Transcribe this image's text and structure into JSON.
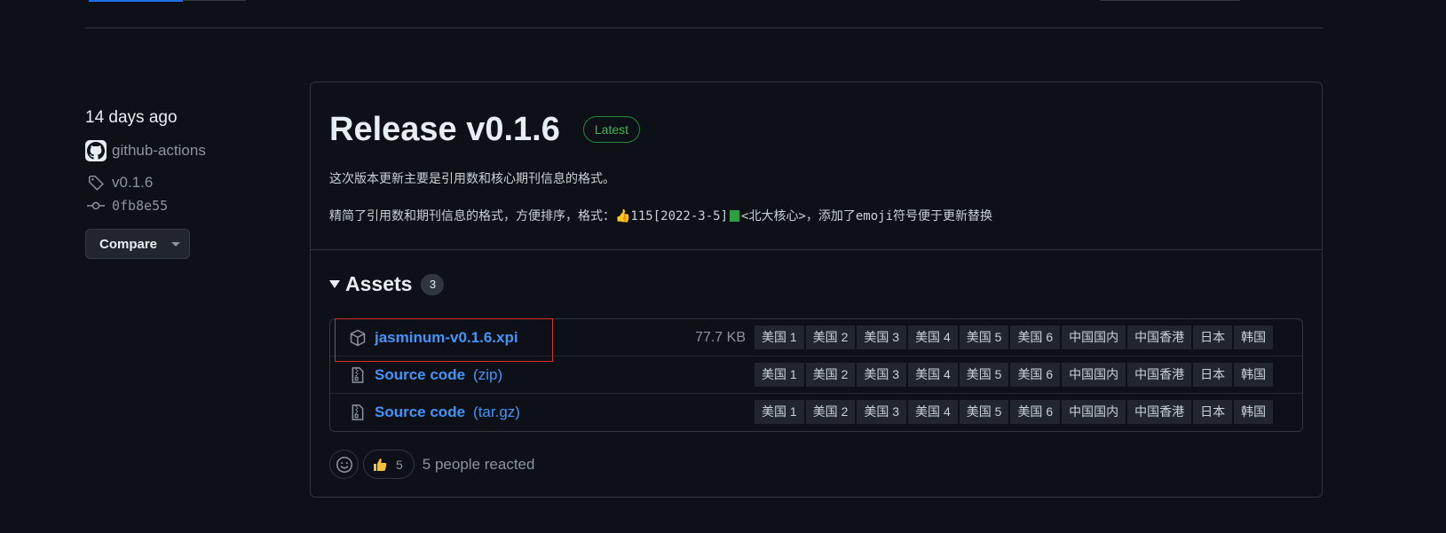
{
  "sidebar": {
    "date": "14 days ago",
    "author": "github-actions",
    "tag": "v0.1.6",
    "commit": "0fb8e55",
    "compare_label": "Compare"
  },
  "release": {
    "title": "Release v0.1.6",
    "badge": "Latest",
    "notes_line1": "这次版本更新主要是引用数和核心期刊信息的格式。",
    "notes_line2_prefix": "精简了引用数和期刊信息的格式，方便排序，格式：👍115[2022-3-5]",
    "notes_line2_suffix": "<北大核心>，添加了emoji符号便于更新替换"
  },
  "assets": {
    "label": "Assets",
    "count": "3",
    "items": [
      {
        "name": "jasminum-v0.1.6.xpi",
        "ext": "",
        "size": "77.7 KB",
        "icon": "package-icon"
      },
      {
        "name": "Source code",
        "ext": "(zip)",
        "size": "",
        "icon": "file-zip-icon"
      },
      {
        "name": "Source code",
        "ext": "(tar.gz)",
        "size": "",
        "icon": "file-zip-icon"
      }
    ],
    "mirrors": [
      "美国 1",
      "美国 2",
      "美国 3",
      "美国 4",
      "美国 5",
      "美国 6",
      "中国国内",
      "中国香港",
      "日本",
      "韩国"
    ]
  },
  "reactions": {
    "thumbs_count": "5",
    "summary": "5 people reacted"
  },
  "colors": {
    "background": "#0d1117",
    "link": "#4493f8",
    "latest_green": "#3fb950",
    "highlight_red": "#d93025"
  }
}
